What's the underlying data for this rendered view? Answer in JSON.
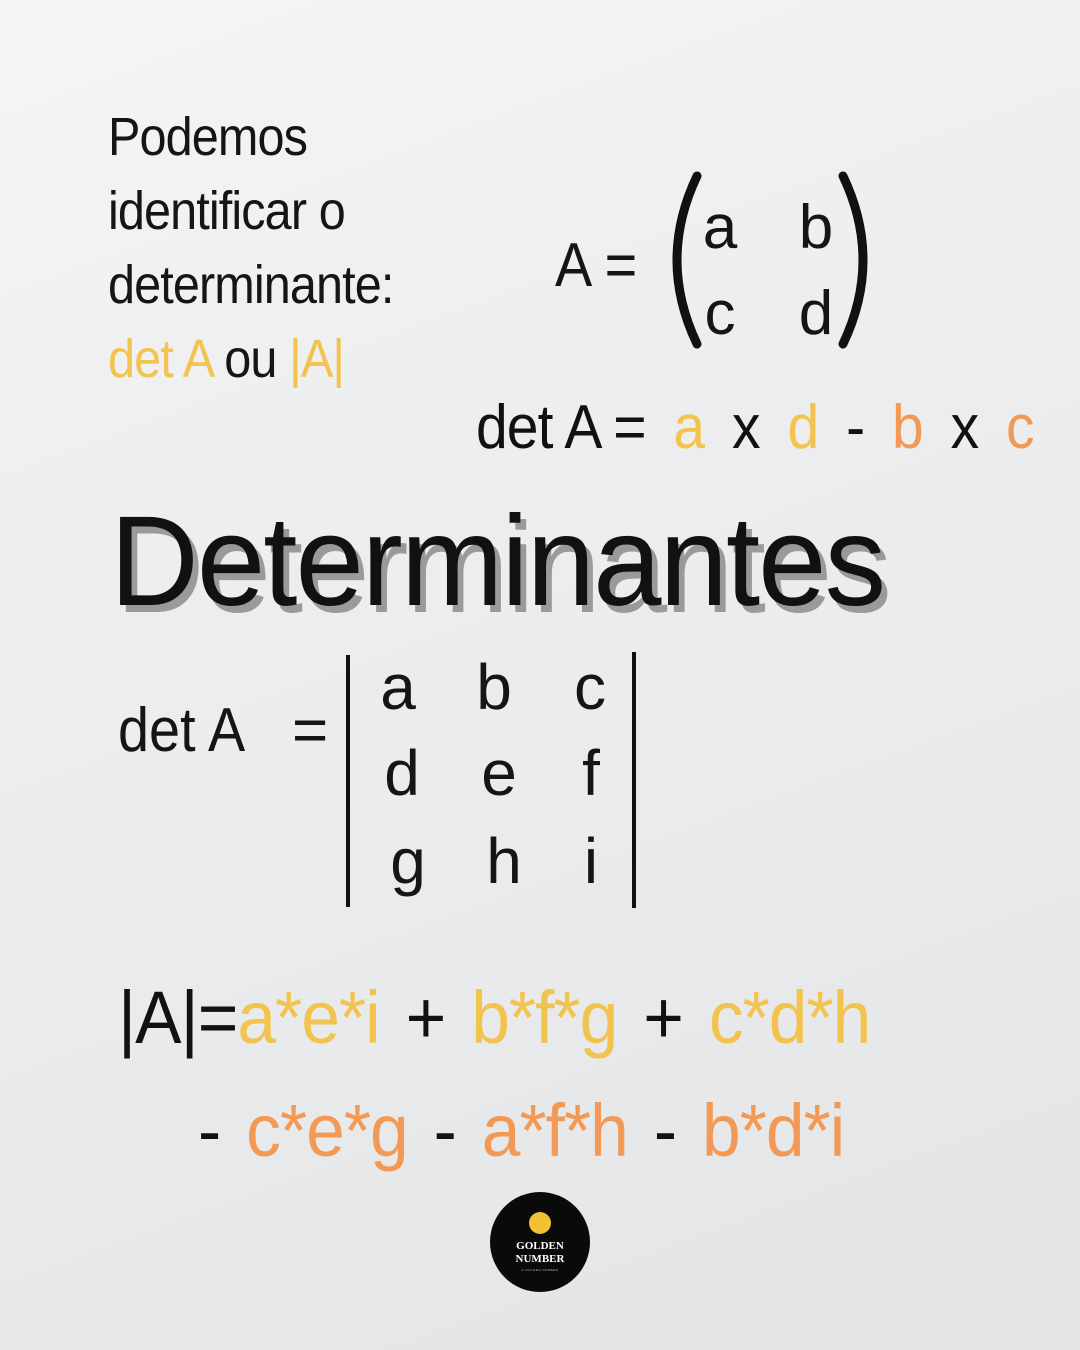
{
  "intro": {
    "line1": "Podemos",
    "line2": "identificar o",
    "line3": "determinante:",
    "notation_det": "det A",
    "notation_or": "ou",
    "notation_abs": "|A|"
  },
  "matrix2": {
    "lhs": "A =",
    "cells": [
      "a",
      "b",
      "c",
      "d"
    ]
  },
  "det2_formula": {
    "lhs": "det A =",
    "parts": [
      "a",
      "x",
      "d",
      "-",
      "b",
      "x",
      "c"
    ]
  },
  "title": "Determinantes",
  "matrix3": {
    "lhs": "det A",
    "eq": "=",
    "cells": [
      "a",
      "b",
      "c",
      "d",
      "e",
      "f",
      "g",
      "h",
      "i"
    ]
  },
  "det3_formula": {
    "line1": [
      "|A|=",
      "a*e*i",
      "+",
      "b*f*g",
      "+",
      "c*d*h"
    ],
    "line2": [
      "-",
      "c*e*g",
      "-",
      "a*f*h",
      "-",
      "b*d*i"
    ]
  },
  "logo": {
    "line1": "GOLDEN",
    "line2": "NUMBER",
    "tagline": "A GOLDEN NUMBER"
  },
  "colors": {
    "yellow": "#f2c34e",
    "orange": "#f29a55",
    "text": "#111111"
  }
}
